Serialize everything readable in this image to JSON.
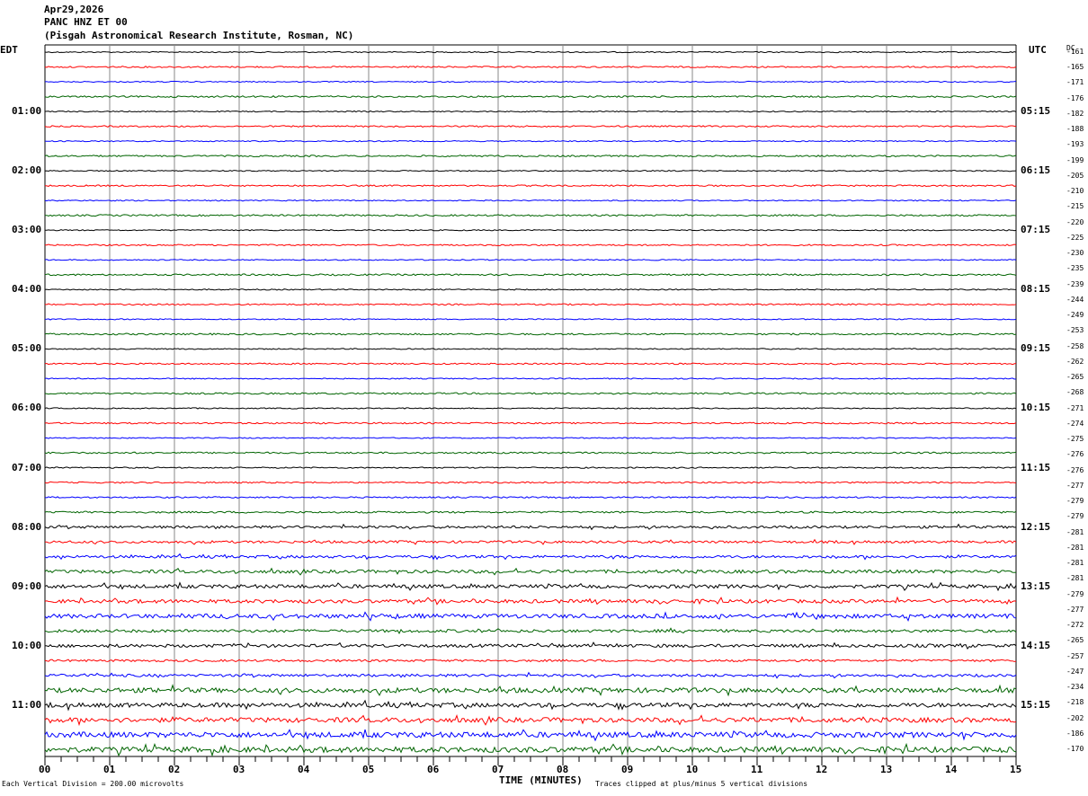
{
  "header": {
    "date": "Apr29,2026",
    "station": "PANC HNZ ET 00",
    "location": "(Pisgah Astronomical Research Institute, Rosman, NC)"
  },
  "left_zone": "EDT",
  "right_zone": "UTC",
  "dc_label": "DC",
  "footer": {
    "scale_note": "Each Vertical Division =  200.00 microvolts",
    "xlabel": "TIME (MINUTES)",
    "clip_note": "Traces clipped at plus/minus 5 vertical divisions"
  },
  "colors": {
    "trace_cycle": [
      "#000000",
      "#ff0000",
      "#0000ff",
      "#006400"
    ],
    "grid": "#888888"
  },
  "chart_data": {
    "type": "line",
    "title": "",
    "xlabel": "TIME (MINUTES)",
    "ylabel": "",
    "x_range": [
      0,
      15
    ],
    "x_ticks": [
      "00",
      "01",
      "02",
      "03",
      "04",
      "05",
      "06",
      "07",
      "08",
      "09",
      "10",
      "11",
      "12",
      "13",
      "14",
      "15"
    ],
    "minor_tick_step_minutes": 0.25,
    "trace_count": 48,
    "minutes_per_trace": 15,
    "edt_hour_labels": [
      "01:00",
      "02:00",
      "03:00",
      "04:00",
      "05:00",
      "06:00",
      "07:00",
      "08:00",
      "09:00",
      "10:00",
      "11:00"
    ],
    "utc_hour_labels": [
      "05:15",
      "06:15",
      "07:15",
      "08:15",
      "09:15",
      "10:15",
      "11:15",
      "12:15",
      "13:15",
      "14:15",
      "15:15"
    ],
    "hour_label_trace_index": [
      4,
      8,
      12,
      16,
      20,
      24,
      28,
      32,
      36,
      40,
      44
    ],
    "dc_offsets": [
      "-161",
      "-165",
      "-171",
      "-176",
      "-182",
      "-188",
      "-193",
      "-199",
      "-205",
      "-210",
      "-215",
      "-220",
      "-225",
      "-230",
      "-235",
      "-239",
      "-244",
      "-249",
      "-253",
      "-258",
      "-262",
      "-265",
      "-268",
      "-271",
      "-274",
      "-275",
      "-276",
      "-276",
      "-277",
      "-279",
      "-279",
      "-281",
      "-281",
      "-281",
      "-281",
      "-279",
      "-277",
      "-272",
      "-265",
      "-257",
      "-247",
      "-234",
      "-218",
      "-202",
      "-186",
      "-170"
    ],
    "noise_amplitude_per_trace": [
      0.6,
      0.8,
      0.6,
      0.9,
      0.6,
      0.8,
      0.6,
      0.9,
      0.6,
      0.8,
      0.6,
      0.9,
      0.6,
      0.8,
      0.6,
      0.9,
      0.6,
      0.8,
      0.6,
      0.9,
      0.6,
      0.8,
      0.6,
      0.9,
      0.6,
      0.8,
      0.6,
      0.9,
      0.7,
      0.8,
      0.8,
      1.0,
      1.4,
      1.3,
      1.5,
      1.8,
      2.0,
      2.0,
      2.3,
      1.6,
      1.7,
      1.2,
      1.5,
      2.6,
      2.4,
      2.6,
      3.0,
      3.0
    ]
  }
}
